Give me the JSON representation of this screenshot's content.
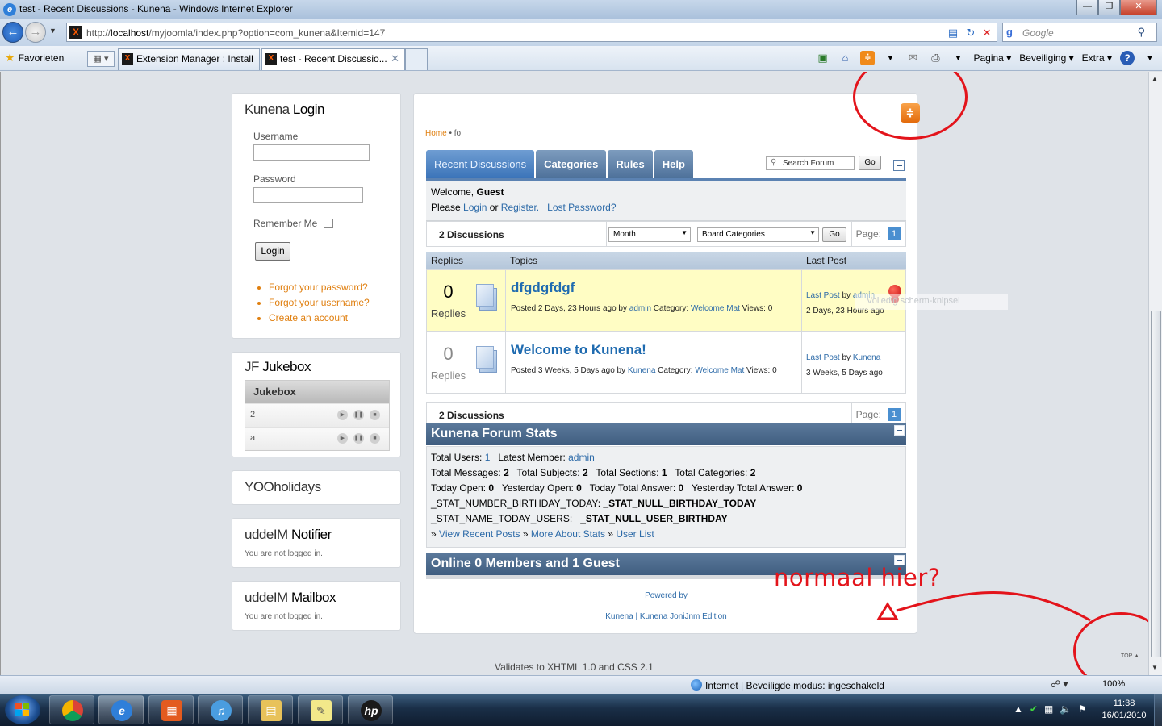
{
  "window": {
    "title": "test - Recent Discussions - Kunena - Windows Internet Explorer",
    "minimize": "0",
    "maximize": "1",
    "close": "r"
  },
  "address": {
    "url_prefix": "http://",
    "url_host": "localhost",
    "url_path": "/myjoomla/index.php?option=com_kunena&Itemid=147"
  },
  "search": {
    "placeholder": "Google"
  },
  "favorites": {
    "label": "Favorieten"
  },
  "tabs": [
    {
      "label": "Extension Manager : Install"
    },
    {
      "label": "test - Recent Discussio..."
    }
  ],
  "command_bar": {
    "page": "Pagina",
    "security": "Beveiliging",
    "extra": "Extra"
  },
  "login_module": {
    "title_a": "Kunena",
    "title_b": "Login",
    "username_label": "Username",
    "password_label": "Password",
    "remember_label": "Remember Me",
    "login_button": "Login",
    "links": [
      "Forgot your password?",
      "Forgot your username?",
      "Create an account"
    ]
  },
  "jukebox_module": {
    "title_a": "JF",
    "title_b": "Jukebox",
    "header": "Jukebox",
    "tracks": [
      "2",
      "a"
    ]
  },
  "yoo_module": {
    "title": "YOOholidays"
  },
  "notifier_module": {
    "title_a": "uddeIM",
    "title_b": "Notifier",
    "text": "You are not logged in."
  },
  "mailbox_module": {
    "title_a": "uddeIM",
    "title_b": "Mailbox",
    "text": "You are not logged in."
  },
  "kunena": {
    "breadcrumb": {
      "home": "Home",
      "sep": "•",
      "current": "fo"
    },
    "tabs": [
      "Recent Discussions",
      "Categories",
      "Rules",
      "Help"
    ],
    "search_placeholder": "Search Forum",
    "go": "Go",
    "welcome": {
      "welcome_text": "Welcome,",
      "user": "Guest",
      "please": "Please",
      "login": "Login",
      "or": "or",
      "register": "Register.",
      "lost_password": "Lost Password?"
    },
    "discussions_count": "2 Discussions",
    "filter_period": "Month",
    "filter_board": "Board Categories",
    "page_label": "Page:",
    "page_num": "1",
    "columns": {
      "replies": "Replies",
      "topics": "Topics",
      "last_post": "Last Post"
    },
    "topics": [
      {
        "replies": "0",
        "replies_label": "Replies",
        "title": "dfgdgfdgf",
        "posted": "Posted 2 Days, 23 Hours ago by",
        "author": "admin",
        "category_label": "Category:",
        "category": "Welcome Mat",
        "views": "Views: 0",
        "last_post_link": "Last Post",
        "by": "by",
        "last_author": "admin",
        "last_time": "2 Days, 23 Hours ago"
      },
      {
        "replies": "0",
        "replies_label": "Replies",
        "title": "Welcome to Kunena!",
        "posted": "Posted 3 Weeks, 5 Days ago by",
        "author": "Kunena",
        "category_label": "Category:",
        "category": "Welcome Mat",
        "views": "Views: 0",
        "last_post_link": "Last Post",
        "by": "by",
        "last_author": "Kunena",
        "last_time": "3 Weeks, 5 Days ago"
      }
    ],
    "stats": {
      "title": "Kunena Forum Stats",
      "total_users_label": "Total Users:",
      "total_users": "1",
      "latest_member_label": "Latest Member:",
      "latest_member": "admin",
      "total_messages_label": "Total Messages:",
      "total_messages": "2",
      "total_subjects_label": "Total Subjects:",
      "total_subjects": "2",
      "total_sections_label": "Total Sections:",
      "total_sections": "1",
      "total_categories_label": "Total Categories:",
      "total_categories": "2",
      "today_open_label": "Today Open:",
      "today_open": "0",
      "yesterday_open_label": "Yesterday Open:",
      "yesterday_open": "0",
      "today_answer_label": "Today Total Answer:",
      "today_answer": "0",
      "yesterday_answer_label": "Yesterday Total Answer:",
      "yesterday_answer": "0",
      "birthday_today_label": "_STAT_NUMBER_BIRTHDAY_TODAY:",
      "birthday_today": "_STAT_NULL_BIRTHDAY_TODAY",
      "birthday_users_label": "_STAT_NAME_TODAY_USERS:",
      "birthday_users": "_STAT_NULL_USER_BIRTHDAY",
      "raquo": "»",
      "view_recent": "View Recent Posts",
      "more_stats": "More About Stats",
      "user_list": "User List"
    },
    "online": {
      "title": "Online 0 Members and 1 Guest"
    },
    "powered_by": "Powered by",
    "credits": "Kunena | Kunena JoniJnm Edition"
  },
  "footer": {
    "validates": "Validates to XHTML 1.0 and CSS 2.1",
    "top": "TOP"
  },
  "ghost_tooltip": "Volledig scherm-knipsel",
  "annotation": {
    "text": "normaal hier?",
    "color": "#e3141b"
  },
  "status_bar": {
    "zone": "Internet | Beveiligde modus: ingeschakeld",
    "zoom": "100%"
  },
  "taskbar": {
    "time": "11:38",
    "date": "16/01/2010"
  }
}
